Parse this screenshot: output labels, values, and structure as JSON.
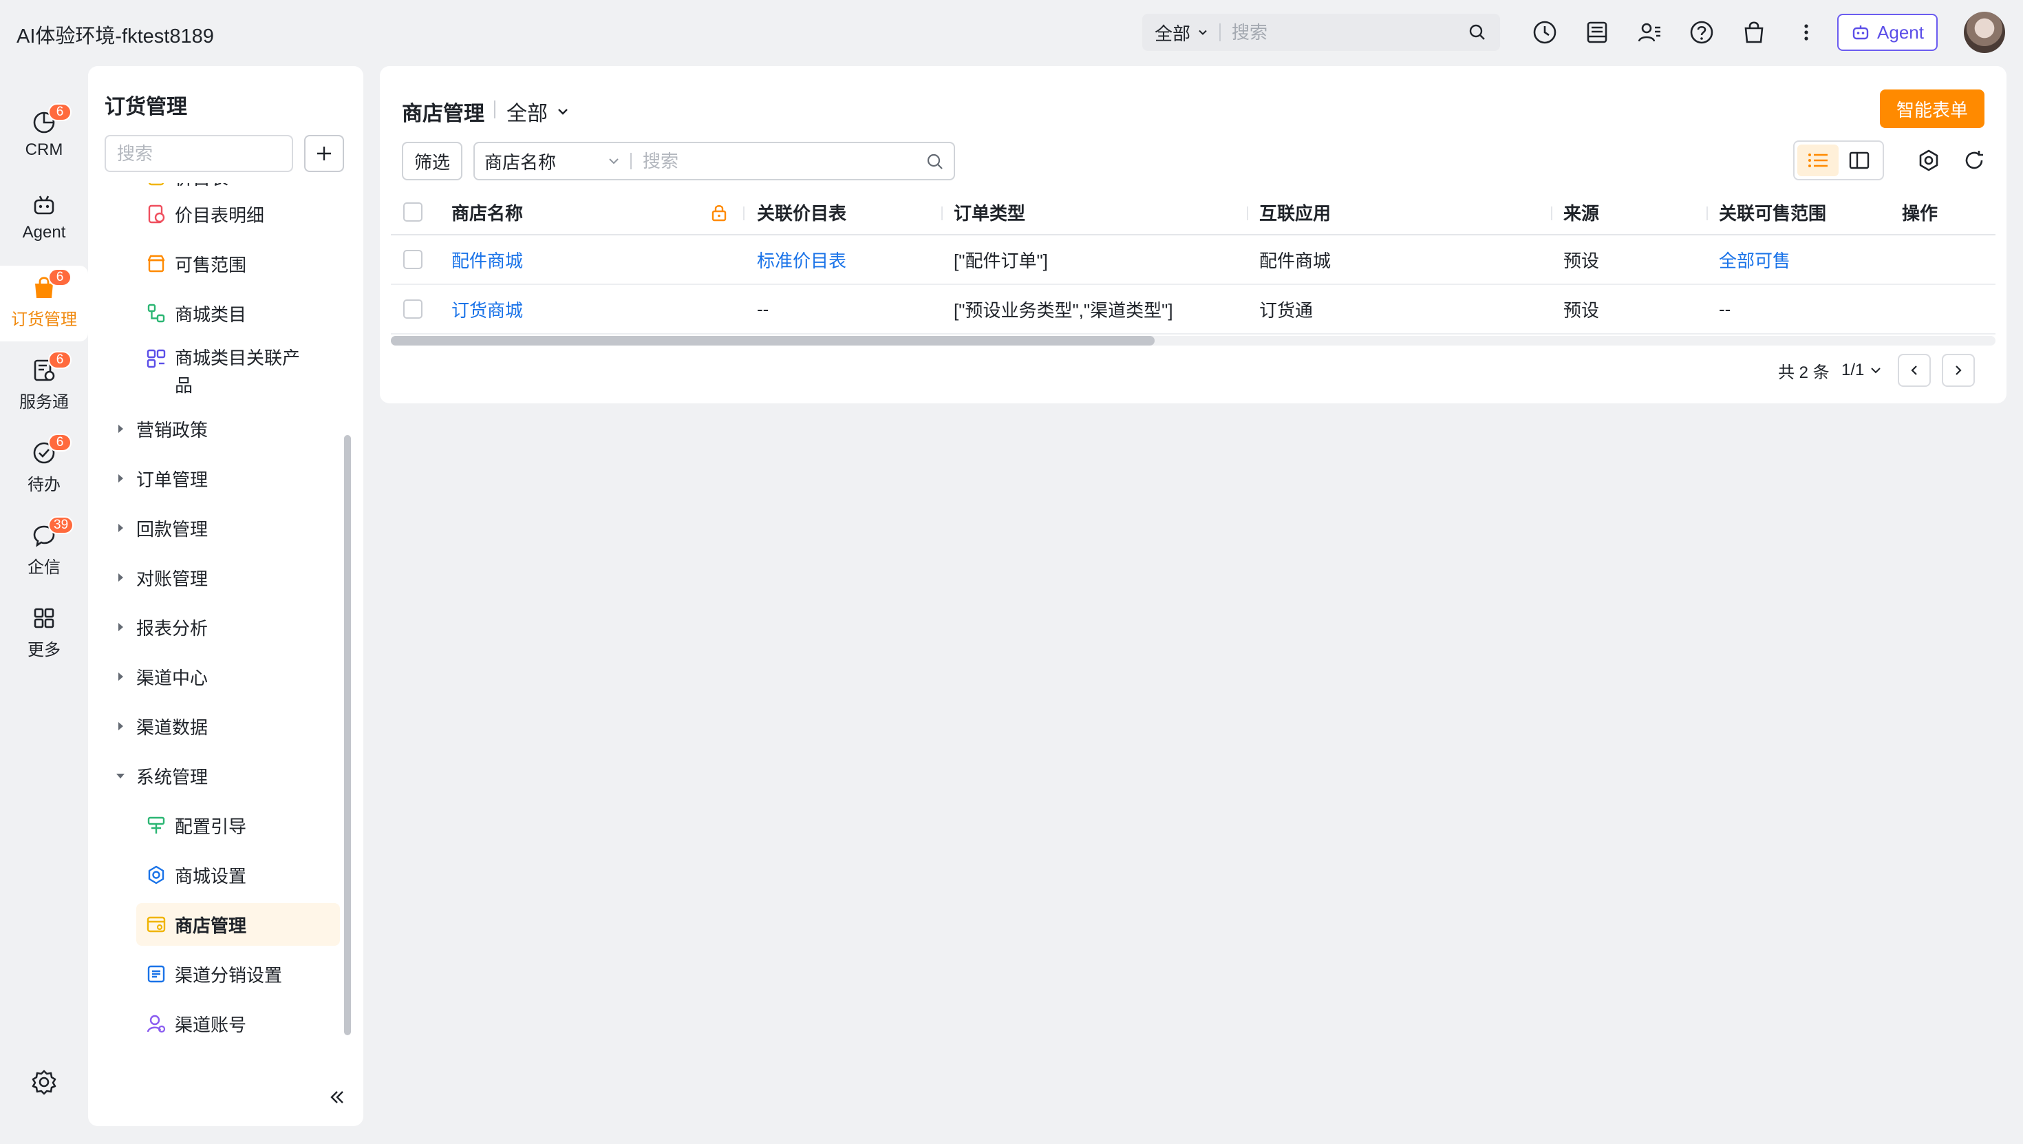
{
  "app": {
    "title": "AI体验环境-fktest8189"
  },
  "global_search": {
    "scope": "全部",
    "placeholder": "搜索"
  },
  "agent_button": {
    "label": "Agent"
  },
  "rail": {
    "items": [
      {
        "label": "CRM",
        "icon": "crm-pie-icon",
        "badge": "6"
      },
      {
        "label": "Agent",
        "icon": "robot-icon",
        "badge": ""
      },
      {
        "label": "订货管理",
        "icon": "shopping-bag-icon",
        "badge": "6",
        "active": true
      },
      {
        "label": "服务通",
        "icon": "service-doc-icon",
        "badge": "6"
      },
      {
        "label": "待办",
        "icon": "check-circle-icon",
        "badge": "6"
      },
      {
        "label": "企信",
        "icon": "chat-bubble-icon",
        "badge": "39"
      },
      {
        "label": "更多",
        "icon": "grid-icon",
        "badge": ""
      }
    ]
  },
  "nav": {
    "title": "订货管理",
    "search_placeholder": "搜索",
    "items": [
      {
        "label": "价目表",
        "type": "child",
        "icon": "price-list-icon"
      },
      {
        "label": "价目表明细",
        "type": "child",
        "icon": "price-detail-icon"
      },
      {
        "label": "可售范围",
        "type": "child",
        "icon": "shop-range-icon"
      },
      {
        "label": "商城类目",
        "type": "child",
        "icon": "category-tree-icon"
      },
      {
        "label": "商城类目关联产品",
        "type": "child",
        "icon": "category-link-icon"
      },
      {
        "label": "营销政策",
        "type": "group",
        "expanded": false
      },
      {
        "label": "订单管理",
        "type": "group",
        "expanded": false
      },
      {
        "label": "回款管理",
        "type": "group",
        "expanded": false
      },
      {
        "label": "对账管理",
        "type": "group",
        "expanded": false
      },
      {
        "label": "报表分析",
        "type": "group",
        "expanded": false
      },
      {
        "label": "渠道中心",
        "type": "group",
        "expanded": false
      },
      {
        "label": "渠道数据",
        "type": "group",
        "expanded": false
      },
      {
        "label": "系统管理",
        "type": "group",
        "expanded": true
      },
      {
        "label": "配置引导",
        "type": "child",
        "icon": "guide-sign-icon"
      },
      {
        "label": "商城设置",
        "type": "child",
        "icon": "settings-gear-icon"
      },
      {
        "label": "商店管理",
        "type": "child",
        "icon": "store-manage-icon",
        "selected": true
      },
      {
        "label": "渠道分销设置",
        "type": "child",
        "icon": "distribution-settings-icon"
      },
      {
        "label": "渠道账号",
        "type": "child",
        "icon": "channel-account-icon"
      }
    ]
  },
  "main": {
    "title": "商店管理",
    "scope": "全部",
    "smart_form_label": "智能表单",
    "filter_label": "筛选",
    "search_field": "商店名称",
    "search_placeholder": "搜索",
    "columns": [
      "商店名称",
      "关联价目表",
      "订单类型",
      "互联应用",
      "来源",
      "关联可售范围",
      "操作"
    ],
    "rows": [
      {
        "name": "配件商城",
        "price_list": "标准价目表",
        "order_type": "[\"配件订单\"]",
        "app": "配件商城",
        "source": "预设",
        "range": "全部可售"
      },
      {
        "name": "订货商城",
        "price_list": "--",
        "order_type": "[\"预设业务类型\",\"渠道类型\"]",
        "app": "订货通",
        "source": "预设",
        "range": "--"
      }
    ],
    "pager": {
      "total": "共 2 条",
      "page": "1/1"
    }
  },
  "colors": {
    "accent": "#ff8a00",
    "link": "#1a73e8",
    "badge": "#ff6a3d",
    "agent": "#5b4ee8"
  }
}
